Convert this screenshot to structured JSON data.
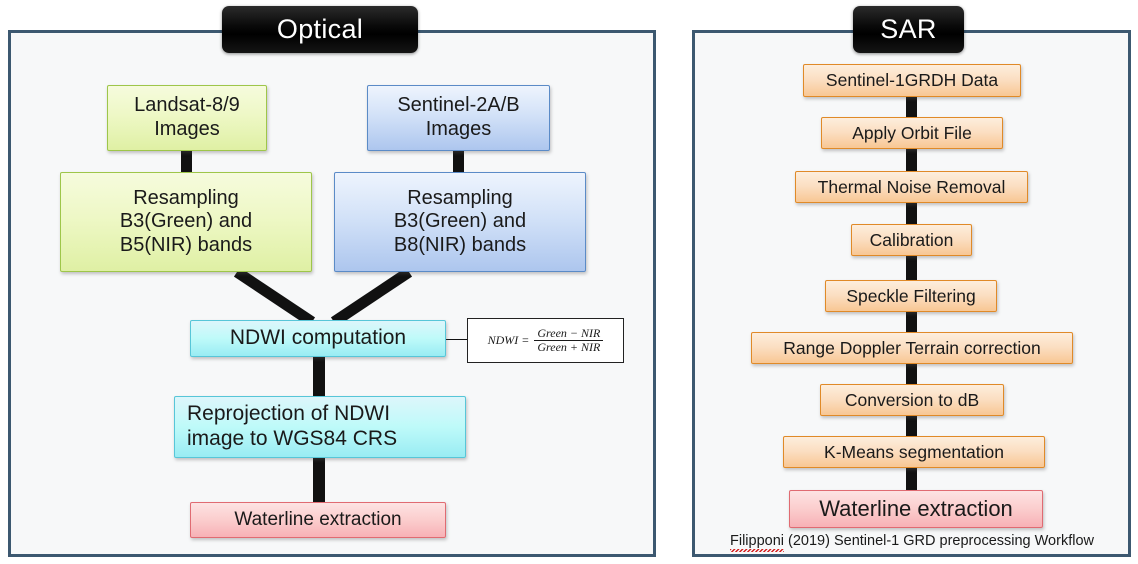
{
  "panels": {
    "optical": {
      "title": "Optical",
      "nodes": {
        "landsat_images": "Landsat-8/9\nImages",
        "landsat_images_l1": "Landsat-8/9",
        "landsat_images_l2": "Images",
        "sentinel2_images_l1": "Sentinel-2A/B",
        "sentinel2_images_l2": "Images",
        "resample_landsat_l1": "Resampling",
        "resample_landsat_l2": "B3(Green) and",
        "resample_landsat_l3": "B5(NIR) bands",
        "resample_sentinel_l1": "Resampling",
        "resample_sentinel_l2": "B3(Green) and",
        "resample_sentinel_l3": "B8(NIR) bands",
        "ndwi_computation": "NDWI computation",
        "reprojection_l1": "Reprojection of NDWI",
        "reprojection_l2": "image to WGS84 CRS",
        "waterline_extraction": "Waterline extraction"
      },
      "formula": {
        "lhs": "NDWI =",
        "numerator": "Green − NIR",
        "denominator": "Green + NIR"
      }
    },
    "sar": {
      "title": "SAR",
      "nodes": {
        "sentinel1_data": "Sentinel-1GRDH Data",
        "apply_orbit_file": "Apply Orbit File",
        "thermal_noise_removal": "Thermal Noise Removal",
        "calibration": "Calibration",
        "speckle_filtering": "Speckle Filtering",
        "range_doppler": "Range Doppler Terrain correction",
        "conversion_db": "Conversion to dB",
        "kmeans_segmentation": "K-Means segmentation",
        "waterline_extraction": "Waterline extraction"
      },
      "caption": {
        "author": "Filipponi",
        "rest": " (2019) Sentinel-1 GRD preprocessing Workflow"
      }
    }
  },
  "colors": {
    "panel_border": "#3c5870",
    "panel_background": "#f7f8f9",
    "tab_background": "#000000",
    "tab_text": "#ffffff",
    "green_fill": "#e9f6bf",
    "green_border": "#9ec64a",
    "blue_fill": "#cfe0f7",
    "blue_border": "#5b8bc7",
    "cyan_fill": "#b6f4f7",
    "cyan_border": "#57c6d8",
    "pink_fill": "#fbcdcd",
    "pink_border": "#e06b72",
    "orange_fill": "#fbdec1",
    "orange_border": "#e08a28",
    "connector": "#111111",
    "spellcheck_underline": "#d41d1d"
  }
}
